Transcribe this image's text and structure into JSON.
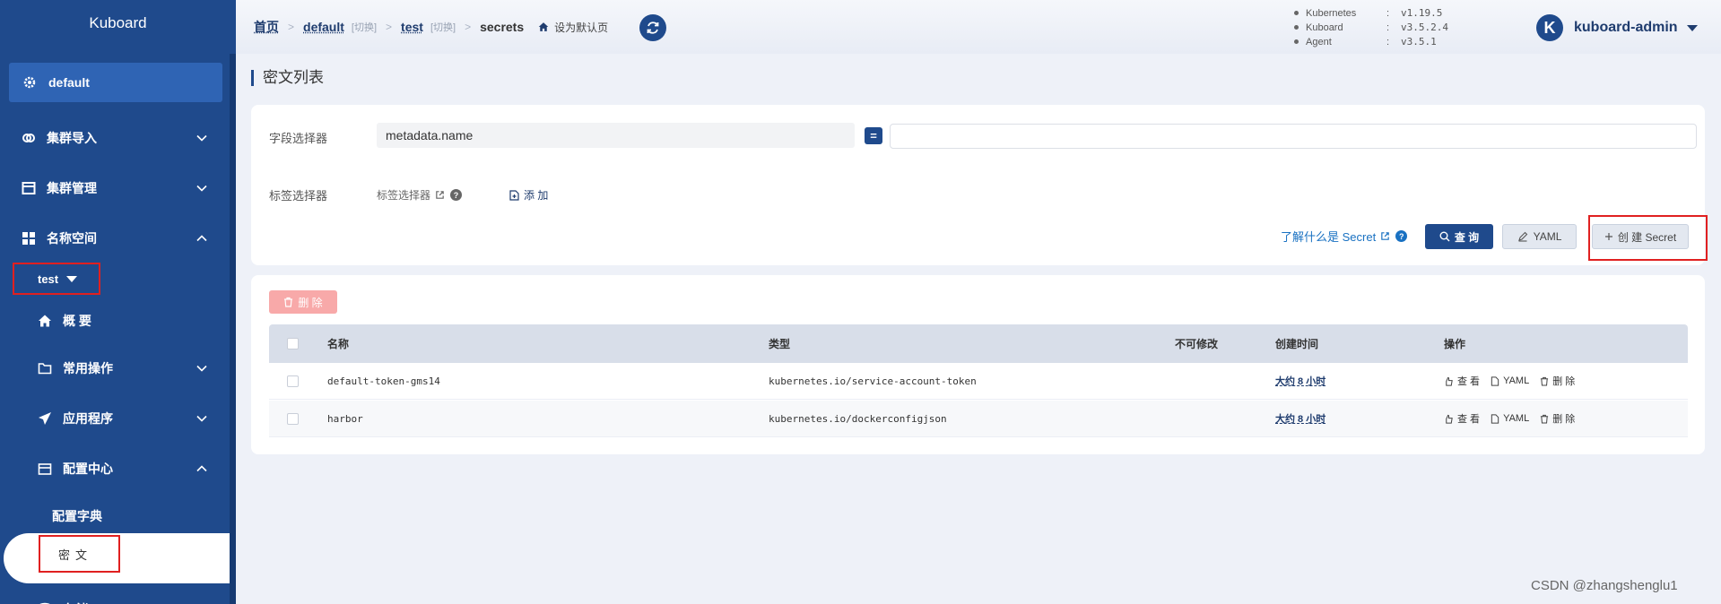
{
  "sidebar": {
    "brand": "Kuboard",
    "cluster": "default",
    "menu": [
      {
        "label": "集群导入",
        "expanded": false
      },
      {
        "label": "集群管理",
        "expanded": false
      },
      {
        "label": "名称空间",
        "expanded": true
      }
    ],
    "namespace": "test",
    "ns_menu": [
      {
        "label": "概 要"
      },
      {
        "label": "常用操作",
        "expanded": false
      },
      {
        "label": "应用程序",
        "expanded": false
      },
      {
        "label": "配置中心",
        "expanded": true
      }
    ],
    "config_items": [
      "配置字典",
      "密文"
    ],
    "partial_item": "存储"
  },
  "header": {
    "breadcrumb": {
      "home": "首页",
      "cluster": "default",
      "namespace": "test",
      "switch": "[切换]",
      "current": "secrets",
      "set_default": "设为默认页"
    },
    "versions": [
      {
        "name": "Kubernetes",
        "colon": ":",
        "value": "v1.19.5"
      },
      {
        "name": "Kuboard",
        "colon": ":",
        "value": "v3.5.2.4"
      },
      {
        "name": "Agent",
        "colon": ":",
        "value": "v3.5.1"
      }
    ],
    "user": {
      "avatar_letter": "K",
      "name": "kuboard-admin"
    }
  },
  "page": {
    "title": "密文列表"
  },
  "filter": {
    "field_selector_label": "字段选择器",
    "field_value": "metadata.name",
    "operator": "=",
    "value_input": "",
    "label_selector_label": "标签选择器",
    "label_selector_link": "标签选择器",
    "add_label": "添 加",
    "learn_link": "了解什么是 Secret",
    "query_label": "查 询",
    "yaml_label": "YAML",
    "create_label": "创 建 Secret"
  },
  "table": {
    "delete_label": "删 除",
    "columns": [
      "名称",
      "类型",
      "不可修改",
      "创建时间",
      "操作"
    ],
    "rows": [
      {
        "name": "default-token-gms14",
        "type": "kubernetes.io/service-account-token",
        "immutable": "",
        "created": "大约 8 小时"
      },
      {
        "name": "harbor",
        "type": "kubernetes.io/dockerconfigjson",
        "immutable": "",
        "created": "大约 8 小时"
      }
    ],
    "actions": {
      "view": "查 看",
      "yaml": "YAML",
      "delete": "删 除"
    }
  },
  "watermark": "CSDN @zhangshenglu1",
  "colors": {
    "sidebar": "#1f4a8c",
    "primary": "#1f4a8c",
    "highlight_border": "#e02020",
    "link": "#1971c2"
  }
}
